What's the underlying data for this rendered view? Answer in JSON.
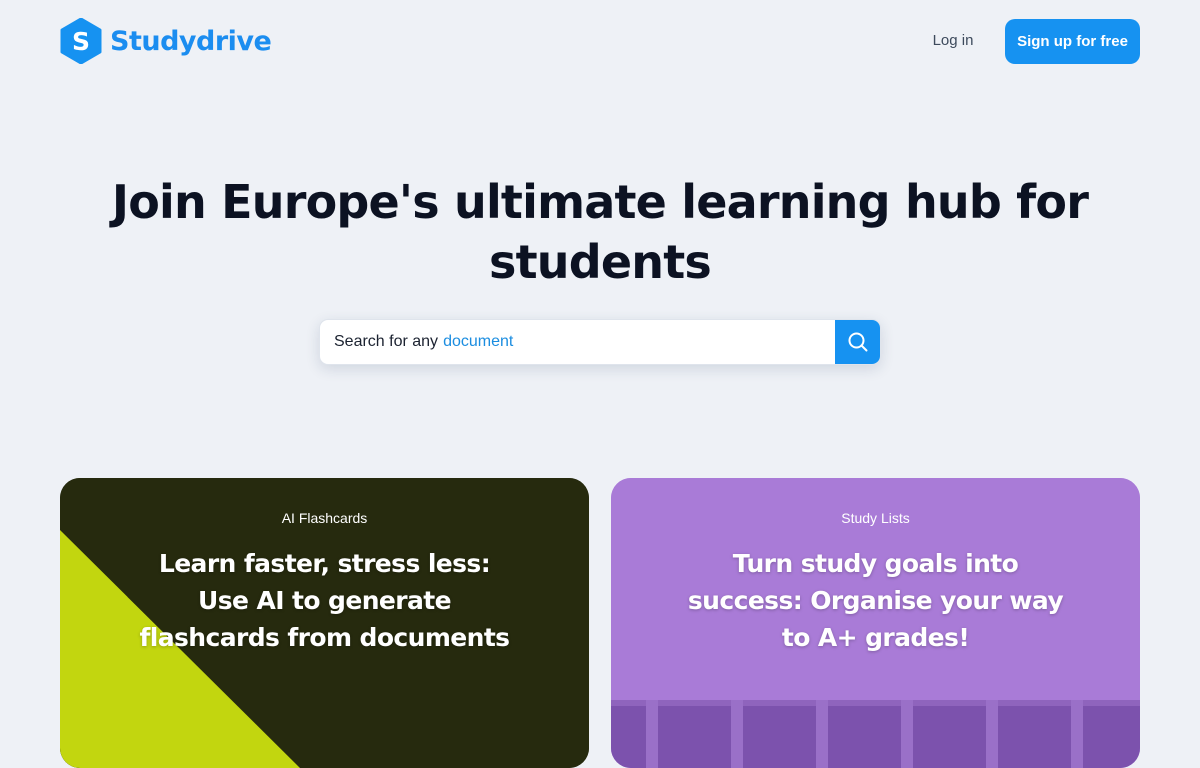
{
  "header": {
    "brand": "Studydrive",
    "login_label": "Log in",
    "signup_label": "Sign up for free"
  },
  "hero": {
    "title": "Join Europe's ultimate learning hub for students"
  },
  "search": {
    "placeholder_prefix": "Search for any",
    "placeholder_highlight": "document"
  },
  "cards": [
    {
      "label": "AI Flashcards",
      "title": "Learn faster, stress less:\nUse AI to generate\nflashcards from documents"
    },
    {
      "label": "Study Lists",
      "title": "Turn study goals into\nsuccess: Organise your way\nto A+ grades!"
    }
  ],
  "colors": {
    "brand_blue": "#1692f1",
    "page_bg": "#eef1f6",
    "flashcard_bg": "#262a0e",
    "flashcard_accent": "#c2d60f",
    "studylist_bg": "#a97bd7"
  },
  "icons": {
    "logo": "studydrive-s-hexagon",
    "search": "search-icon"
  }
}
